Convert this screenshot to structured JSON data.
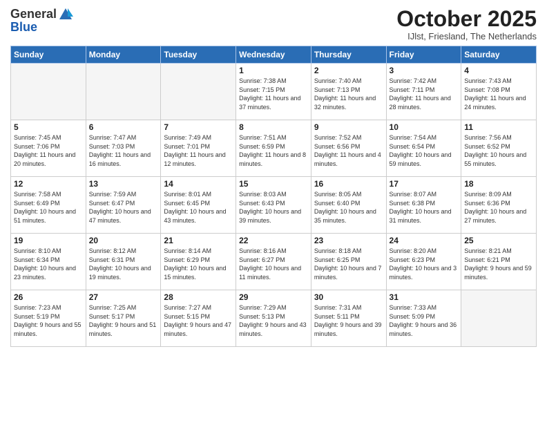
{
  "header": {
    "logo_general": "General",
    "logo_blue": "Blue",
    "month_title": "October 2025",
    "subtitle": "IJlst, Friesland, The Netherlands"
  },
  "days_of_week": [
    "Sunday",
    "Monday",
    "Tuesday",
    "Wednesday",
    "Thursday",
    "Friday",
    "Saturday"
  ],
  "weeks": [
    [
      {
        "day": "",
        "info": ""
      },
      {
        "day": "",
        "info": ""
      },
      {
        "day": "",
        "info": ""
      },
      {
        "day": "1",
        "info": "Sunrise: 7:38 AM\nSunset: 7:15 PM\nDaylight: 11 hours\nand 37 minutes."
      },
      {
        "day": "2",
        "info": "Sunrise: 7:40 AM\nSunset: 7:13 PM\nDaylight: 11 hours\nand 32 minutes."
      },
      {
        "day": "3",
        "info": "Sunrise: 7:42 AM\nSunset: 7:11 PM\nDaylight: 11 hours\nand 28 minutes."
      },
      {
        "day": "4",
        "info": "Sunrise: 7:43 AM\nSunset: 7:08 PM\nDaylight: 11 hours\nand 24 minutes."
      }
    ],
    [
      {
        "day": "5",
        "info": "Sunrise: 7:45 AM\nSunset: 7:06 PM\nDaylight: 11 hours\nand 20 minutes."
      },
      {
        "day": "6",
        "info": "Sunrise: 7:47 AM\nSunset: 7:03 PM\nDaylight: 11 hours\nand 16 minutes."
      },
      {
        "day": "7",
        "info": "Sunrise: 7:49 AM\nSunset: 7:01 PM\nDaylight: 11 hours\nand 12 minutes."
      },
      {
        "day": "8",
        "info": "Sunrise: 7:51 AM\nSunset: 6:59 PM\nDaylight: 11 hours\nand 8 minutes."
      },
      {
        "day": "9",
        "info": "Sunrise: 7:52 AM\nSunset: 6:56 PM\nDaylight: 11 hours\nand 4 minutes."
      },
      {
        "day": "10",
        "info": "Sunrise: 7:54 AM\nSunset: 6:54 PM\nDaylight: 10 hours\nand 59 minutes."
      },
      {
        "day": "11",
        "info": "Sunrise: 7:56 AM\nSunset: 6:52 PM\nDaylight: 10 hours\nand 55 minutes."
      }
    ],
    [
      {
        "day": "12",
        "info": "Sunrise: 7:58 AM\nSunset: 6:49 PM\nDaylight: 10 hours\nand 51 minutes."
      },
      {
        "day": "13",
        "info": "Sunrise: 7:59 AM\nSunset: 6:47 PM\nDaylight: 10 hours\nand 47 minutes."
      },
      {
        "day": "14",
        "info": "Sunrise: 8:01 AM\nSunset: 6:45 PM\nDaylight: 10 hours\nand 43 minutes."
      },
      {
        "day": "15",
        "info": "Sunrise: 8:03 AM\nSunset: 6:43 PM\nDaylight: 10 hours\nand 39 minutes."
      },
      {
        "day": "16",
        "info": "Sunrise: 8:05 AM\nSunset: 6:40 PM\nDaylight: 10 hours\nand 35 minutes."
      },
      {
        "day": "17",
        "info": "Sunrise: 8:07 AM\nSunset: 6:38 PM\nDaylight: 10 hours\nand 31 minutes."
      },
      {
        "day": "18",
        "info": "Sunrise: 8:09 AM\nSunset: 6:36 PM\nDaylight: 10 hours\nand 27 minutes."
      }
    ],
    [
      {
        "day": "19",
        "info": "Sunrise: 8:10 AM\nSunset: 6:34 PM\nDaylight: 10 hours\nand 23 minutes."
      },
      {
        "day": "20",
        "info": "Sunrise: 8:12 AM\nSunset: 6:31 PM\nDaylight: 10 hours\nand 19 minutes."
      },
      {
        "day": "21",
        "info": "Sunrise: 8:14 AM\nSunset: 6:29 PM\nDaylight: 10 hours\nand 15 minutes."
      },
      {
        "day": "22",
        "info": "Sunrise: 8:16 AM\nSunset: 6:27 PM\nDaylight: 10 hours\nand 11 minutes."
      },
      {
        "day": "23",
        "info": "Sunrise: 8:18 AM\nSunset: 6:25 PM\nDaylight: 10 hours\nand 7 minutes."
      },
      {
        "day": "24",
        "info": "Sunrise: 8:20 AM\nSunset: 6:23 PM\nDaylight: 10 hours\nand 3 minutes."
      },
      {
        "day": "25",
        "info": "Sunrise: 8:21 AM\nSunset: 6:21 PM\nDaylight: 9 hours\nand 59 minutes."
      }
    ],
    [
      {
        "day": "26",
        "info": "Sunrise: 7:23 AM\nSunset: 5:19 PM\nDaylight: 9 hours\nand 55 minutes."
      },
      {
        "day": "27",
        "info": "Sunrise: 7:25 AM\nSunset: 5:17 PM\nDaylight: 9 hours\nand 51 minutes."
      },
      {
        "day": "28",
        "info": "Sunrise: 7:27 AM\nSunset: 5:15 PM\nDaylight: 9 hours\nand 47 minutes."
      },
      {
        "day": "29",
        "info": "Sunrise: 7:29 AM\nSunset: 5:13 PM\nDaylight: 9 hours\nand 43 minutes."
      },
      {
        "day": "30",
        "info": "Sunrise: 7:31 AM\nSunset: 5:11 PM\nDaylight: 9 hours\nand 39 minutes."
      },
      {
        "day": "31",
        "info": "Sunrise: 7:33 AM\nSunset: 5:09 PM\nDaylight: 9 hours\nand 36 minutes."
      },
      {
        "day": "",
        "info": ""
      }
    ]
  ]
}
